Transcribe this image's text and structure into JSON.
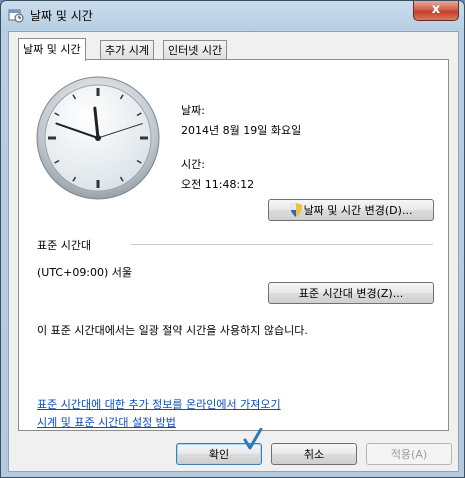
{
  "window": {
    "title": "날짜 및 시간",
    "close_label": "x"
  },
  "tabs": [
    {
      "label": "날짜 및 시간",
      "active": true
    },
    {
      "label": "추가 시계",
      "active": false
    },
    {
      "label": "인터넷 시간",
      "active": false
    }
  ],
  "date": {
    "label": "날짜:",
    "value": "2014년 8월 19일 화요일"
  },
  "time": {
    "label": "시간:",
    "value": "오전 11:48:12"
  },
  "buttons": {
    "change_datetime": "날짜 및 시간 변경(D)...",
    "change_timezone": "표준 시간대 변경(Z)...",
    "ok": "확인",
    "cancel": "취소",
    "apply": "적용(A)"
  },
  "timezone": {
    "heading": "표준 시간대",
    "value": "(UTC+09:00) 서울",
    "dst_note": "이 표준 시간대에서는 일광 절약 시간을 사용하지 않습니다."
  },
  "links": {
    "more_info": "표준 시간대에 대한 추가 정보를 온라인에서 가져오기",
    "how_to": "시계 및 표준 시간대 설정 방법"
  },
  "clock": {
    "hour": 11,
    "minute": 48,
    "second": 12
  },
  "colors": {
    "link": "#0a4fb5",
    "title_gradient": "#b8cfe3",
    "close": "#c33f2a",
    "check": "#2b78c2"
  }
}
